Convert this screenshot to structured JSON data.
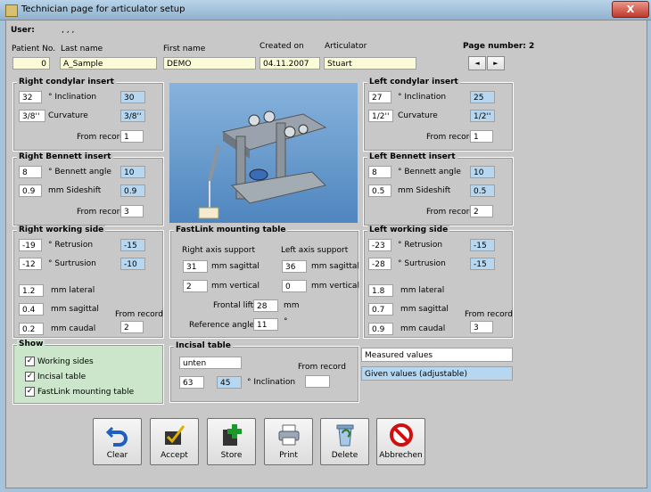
{
  "window": {
    "title": "Technician page for articulator setup",
    "close": "X"
  },
  "header": {
    "user_label": "User:",
    "user_value": ", , ,",
    "patient_no_label": "Patient No.",
    "patient_no": "0",
    "last_name_label": "Last name",
    "last_name": "A_Sample",
    "first_name_label": "First name",
    "first_name": "DEMO",
    "created_on_label": "Created on",
    "created_on": "04.11.2007",
    "articulator_label": "Articulator",
    "articulator": "Stuart",
    "page_number_label": "Page number: 2",
    "page_prev": "◄",
    "page_next": "►"
  },
  "right_condylar": {
    "title": "Right condylar insert",
    "inclination_label": "° Inclination",
    "inclination": "32",
    "inclination_given": "30",
    "curvature_label": "Curvature",
    "curvature": "3/8''",
    "curvature_given": "3/8''",
    "from_record_label": "From record",
    "from_record": "1"
  },
  "left_condylar": {
    "title": "Left condylar insert",
    "inclination_label": "° Inclination",
    "inclination": "27",
    "inclination_given": "25",
    "curvature_label": "Curvature",
    "curvature": "1/2''",
    "curvature_given": "1/2''",
    "from_record_label": "From record",
    "from_record": "1"
  },
  "right_bennett": {
    "title": "Right Bennett insert",
    "angle_label": "° Bennett angle",
    "angle": "8",
    "angle_given": "10",
    "sideshift_label": "mm Sideshift",
    "sideshift": "0.9",
    "sideshift_given": "0.9",
    "from_record_label": "From record",
    "from_record": "3"
  },
  "left_bennett": {
    "title": "Left Bennett insert",
    "angle_label": "° Bennett angle",
    "angle": "8",
    "angle_given": "10",
    "sideshift_label": "mm Sideshift",
    "sideshift": "0.5",
    "sideshift_given": "0.5",
    "from_record_label": "From record",
    "from_record": "2"
  },
  "right_working": {
    "title": "Right working side",
    "retrusion_label": "° Retrusion",
    "retrusion": "-19",
    "retrusion_given": "-15",
    "surtrusion_label": "° Surtrusion",
    "surtrusion": "-12",
    "surtrusion_given": "-10",
    "lateral_label": "mm lateral",
    "lateral": "1.2",
    "sagittal_label": "mm sagittal",
    "sagittal": "0.4",
    "caudal_label": "mm caudal",
    "caudal": "0.2",
    "from_record_label": "From record",
    "from_record": "2"
  },
  "left_working": {
    "title": "Left working side",
    "retrusion_label": "° Retrusion",
    "retrusion": "-23",
    "retrusion_given": "-15",
    "surtrusion_label": "° Surtrusion",
    "surtrusion": "-28",
    "surtrusion_given": "-15",
    "lateral_label": "mm lateral",
    "lateral": "1.8",
    "sagittal_label": "mm sagittal",
    "sagittal": "0.7",
    "caudal_label": "mm caudal",
    "caudal": "0.9",
    "from_record_label": "From record",
    "from_record": "3"
  },
  "fastlink": {
    "title": "FastLink mounting table",
    "right_axis_label": "Right axis support",
    "left_axis_label": "Left axis support",
    "right_sagittal": "31",
    "left_sagittal": "36",
    "sagittal_label": "mm sagittal",
    "right_vertical": "2",
    "left_vertical": "0",
    "vertical_label": "mm vertical",
    "frontal_lift_label": "Frontal lift",
    "frontal_lift": "28",
    "mm_label": "mm",
    "reference_angle_label": "Reference angle",
    "reference_angle": "11",
    "degree_label": "°"
  },
  "show": {
    "title": "Show",
    "working_sides": "Working sides",
    "incisal_table": "Incisal table",
    "fastlink_table": "FastLink mounting table",
    "check_mark": "✓"
  },
  "incisal": {
    "title": "Incisal table",
    "name": "unten",
    "from_record_label": "From record",
    "from_record": "",
    "inclination": "63",
    "inclination_given": "45",
    "inclination_label": "° Inclination"
  },
  "legend": {
    "measured": "Measured values",
    "given": "Given values (adjustable)"
  },
  "buttons": {
    "clear": "Clear",
    "accept": "Accept",
    "store": "Store",
    "print": "Print",
    "delete": "Delete",
    "cancel": "Abbrechen"
  },
  "colors": {
    "given_bg": "#b7d7f0",
    "show_bg": "#cbe6cb",
    "header_field_bg": "#fcfbd7",
    "photo_bg": "#6b9ccc"
  }
}
